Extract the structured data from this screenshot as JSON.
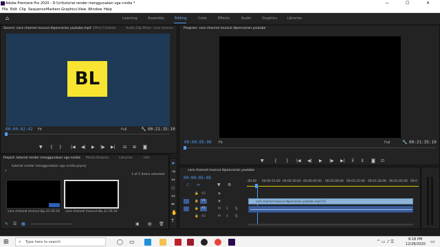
{
  "window": {
    "title": "Adobe Premiere Pro 2020 - D:\\\\rr\\tutorial render menggunakan vga nvidia *",
    "minimize": "—",
    "maximize": "☐",
    "close": "✕"
  },
  "menu": [
    "File",
    "Edit",
    "Clip",
    "Sequence",
    "Markers",
    "Graphics",
    "View",
    "Window",
    "Help"
  ],
  "workspaces": [
    "Learning",
    "Assembly",
    "Editing",
    "Color",
    "Effects",
    "Audio",
    "Graphics",
    "Libraries"
  ],
  "source": {
    "tabs": [
      "Source: cara channel muncul dipencarian youtube.mp4",
      "Effect Controls",
      "Audio Clip Mixer: cara channe"
    ],
    "logo_text": "BL",
    "timecode": "00:00:02:42",
    "fit": "Fit",
    "quality": "Full",
    "duration": "00:21:35:10"
  },
  "program": {
    "tab": "Program: cara channel muncul dipencarian youtube",
    "timecode": "00:00:05:00",
    "fit": "Fit",
    "quality": "Full",
    "duration": "00:21:35:10"
  },
  "project": {
    "tabs": [
      "Project: tutorial render menggunakan vga nvidia",
      "Media Browser",
      "Libraries",
      "Info"
    ],
    "file": "tutorial render menggunakan vga nvidia.prproj",
    "selection": "1 of 2 items selected",
    "items": [
      {
        "name": "cara channel muncul dip...",
        "duration": "21:35:10"
      },
      {
        "name": "cara channel muncul dip...",
        "duration": "21:35:10"
      }
    ]
  },
  "timeline": {
    "tab": "cara channel muncul dipencarian youtube",
    "timecode": "00:00:05:48",
    "ruler": [
      ":00:00",
      "00:00:15:00",
      "00:00:30:00",
      "00:00:45:00",
      "00:01:00:00",
      "00:01:15:00",
      "00:01:30:00",
      "00:01:45:00",
      "00:0"
    ],
    "tracks": [
      "V2",
      "V1",
      "A1",
      "A2"
    ],
    "clip_label": "cara channel muncul dipencarian youtube.mp4 [V]"
  },
  "taskbar": {
    "search_placeholder": "Type here to search",
    "time": "8:18 PM",
    "date": "12/28/2020"
  },
  "colors": {
    "accent": "#4e9ef8",
    "logo_bg": "#f7e531",
    "clip_video": "#8fb4d8",
    "clip_audio": "#3b5d9a",
    "playhead": "#4e9ef8"
  }
}
